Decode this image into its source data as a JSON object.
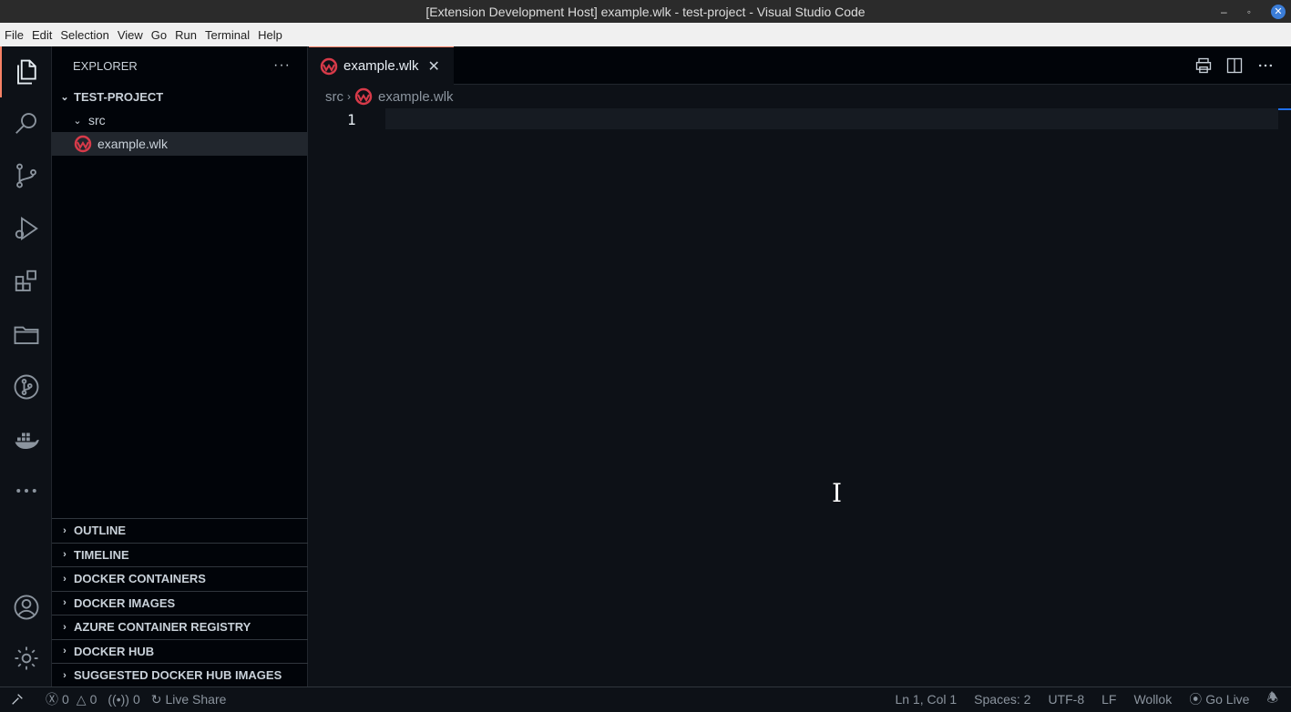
{
  "window": {
    "title": "[Extension Development Host] example.wlk - test-project - Visual Studio Code"
  },
  "menu": [
    "File",
    "Edit",
    "Selection",
    "View",
    "Go",
    "Run",
    "Terminal",
    "Help"
  ],
  "sidebar": {
    "title": "EXPLORER",
    "project": "TEST-PROJECT",
    "folder": "src",
    "file": "example.wlk",
    "panels": [
      "OUTLINE",
      "TIMELINE",
      "DOCKER CONTAINERS",
      "DOCKER IMAGES",
      "AZURE CONTAINER REGISTRY",
      "DOCKER HUB",
      "SUGGESTED DOCKER HUB IMAGES"
    ]
  },
  "editor": {
    "tab_label": "example.wlk",
    "breadcrumb_folder": "src",
    "breadcrumb_file": "example.wlk",
    "line_number": "1"
  },
  "statusbar": {
    "errors": "0",
    "warnings": "0",
    "ports": "0",
    "live_share": "Live Share",
    "position": "Ln 1, Col 1",
    "spaces": "Spaces: 2",
    "encoding": "UTF-8",
    "eol": "LF",
    "language": "Wollok",
    "go_live": "Go Live"
  },
  "colors": {
    "accent": "#f78166",
    "wollok_red": "#d73a49",
    "background": "#0d1117"
  }
}
